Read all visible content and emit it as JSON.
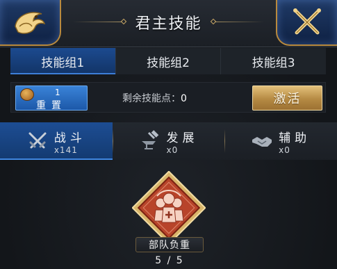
{
  "header": {
    "title": "君主技能",
    "back_icon": "dragon-back-icon",
    "close_icon": "close-x-icon"
  },
  "tabs": [
    {
      "label": "技能组1",
      "active": true
    },
    {
      "label": "技能组2",
      "active": false
    },
    {
      "label": "技能组3",
      "active": false
    }
  ],
  "points": {
    "reset_count": "1",
    "reset_label": "重置",
    "remaining_label": "剩余技能点：",
    "remaining_value": "0",
    "activate_label": "激活"
  },
  "categories": [
    {
      "name": "战斗",
      "count": "x141",
      "icon": "crossed-swords-icon",
      "active": true
    },
    {
      "name": "发展",
      "count": "x0",
      "icon": "anvil-hammer-icon",
      "active": false
    },
    {
      "name": "辅助",
      "count": "x0",
      "icon": "handshake-icon",
      "active": false
    }
  ],
  "skill": {
    "name": "部队负重",
    "level": "5 / 5",
    "icon": "troop-load-icon"
  },
  "colors": {
    "active_blue": "#1c4a8f",
    "gold_button": "#c9a35c",
    "skill_red": "#b8442a"
  }
}
